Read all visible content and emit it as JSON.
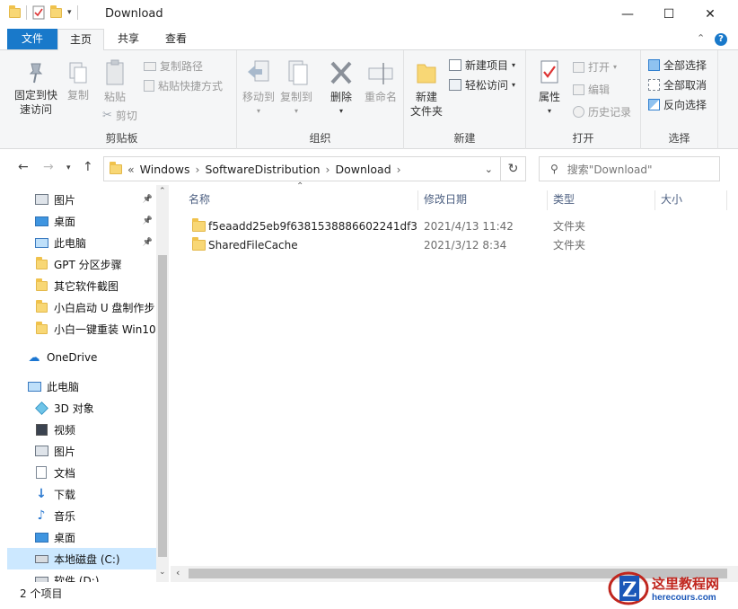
{
  "window": {
    "title": "Download",
    "minimize": "—",
    "maximize": "☐",
    "close": "✕"
  },
  "tabs": [
    {
      "label": "文件"
    },
    {
      "label": "主页"
    },
    {
      "label": "共享"
    },
    {
      "label": "查看"
    }
  ],
  "ribbon": {
    "clipboard": {
      "label": "剪贴板",
      "pin": "固定到快\n速访问",
      "pin1": "固定到快",
      "pin2": "速访问",
      "copy": "复制",
      "paste": "粘贴",
      "copy_path": "复制路径",
      "paste_shortcut": "粘贴快捷方式",
      "cut": "剪切"
    },
    "organize": {
      "label": "组织",
      "move_to": "移动到",
      "copy_to": "复制到",
      "delete": "删除",
      "rename": "重命名"
    },
    "new": {
      "label": "新建",
      "new_folder1": "新建",
      "new_folder2": "文件夹",
      "new_item": "新建项目",
      "easy_access": "轻松访问"
    },
    "open": {
      "label": "打开",
      "properties": "属性",
      "open": "打开",
      "edit": "编辑",
      "history": "历史记录"
    },
    "select": {
      "label": "选择",
      "select_all": "全部选择",
      "select_none": "全部取消",
      "invert": "反向选择"
    }
  },
  "address": {
    "prefix": "«",
    "crumbs": [
      "Windows",
      "SoftwareDistribution",
      "Download"
    ],
    "search_placeholder": "搜索\"Download\""
  },
  "nav": {
    "items": [
      {
        "label": "图片",
        "icon": "pictures-icon",
        "pinned": true
      },
      {
        "label": "桌面",
        "icon": "desktop-icon",
        "pinned": true
      },
      {
        "label": "此电脑",
        "icon": "computer-icon",
        "pinned": true
      },
      {
        "label": "GPT 分区步骤",
        "icon": "folder-icon"
      },
      {
        "label": "其它软件截图",
        "icon": "folder-icon"
      },
      {
        "label": "小白启动 U 盘制作步",
        "icon": "folder-icon"
      },
      {
        "label": "小白一键重装 Win10",
        "icon": "folder-icon"
      },
      {
        "label": "OneDrive",
        "icon": "onedrive-icon"
      },
      {
        "label": "此电脑",
        "icon": "computer-icon"
      },
      {
        "label": "3D 对象",
        "icon": "3d-objects-icon"
      },
      {
        "label": "视频",
        "icon": "videos-icon"
      },
      {
        "label": "图片",
        "icon": "pictures-icon"
      },
      {
        "label": "文档",
        "icon": "documents-icon"
      },
      {
        "label": "下载",
        "icon": "downloads-icon"
      },
      {
        "label": "音乐",
        "icon": "music-icon"
      },
      {
        "label": "桌面",
        "icon": "desktop-icon"
      },
      {
        "label": "本地磁盘 (C:)",
        "icon": "drive-icon"
      },
      {
        "label": "软件 (D:)",
        "icon": "drive-icon"
      }
    ]
  },
  "columns": {
    "name": "名称",
    "date": "修改日期",
    "type": "类型",
    "size": "大小"
  },
  "files": [
    {
      "name": "f5eaadd25eb9f6381538886602241df3",
      "date": "2021/4/13 11:42",
      "type": "文件夹"
    },
    {
      "name": "SharedFileCache",
      "date": "2021/3/12 8:34",
      "type": "文件夹"
    }
  ],
  "status": {
    "count": "2 个项目"
  },
  "watermark": {
    "title": "这里教程网",
    "url": "herecours.com"
  },
  "colors": {
    "file_tab": "#1979ca",
    "selected": "#cce8ff",
    "folder": "#f8d775"
  }
}
